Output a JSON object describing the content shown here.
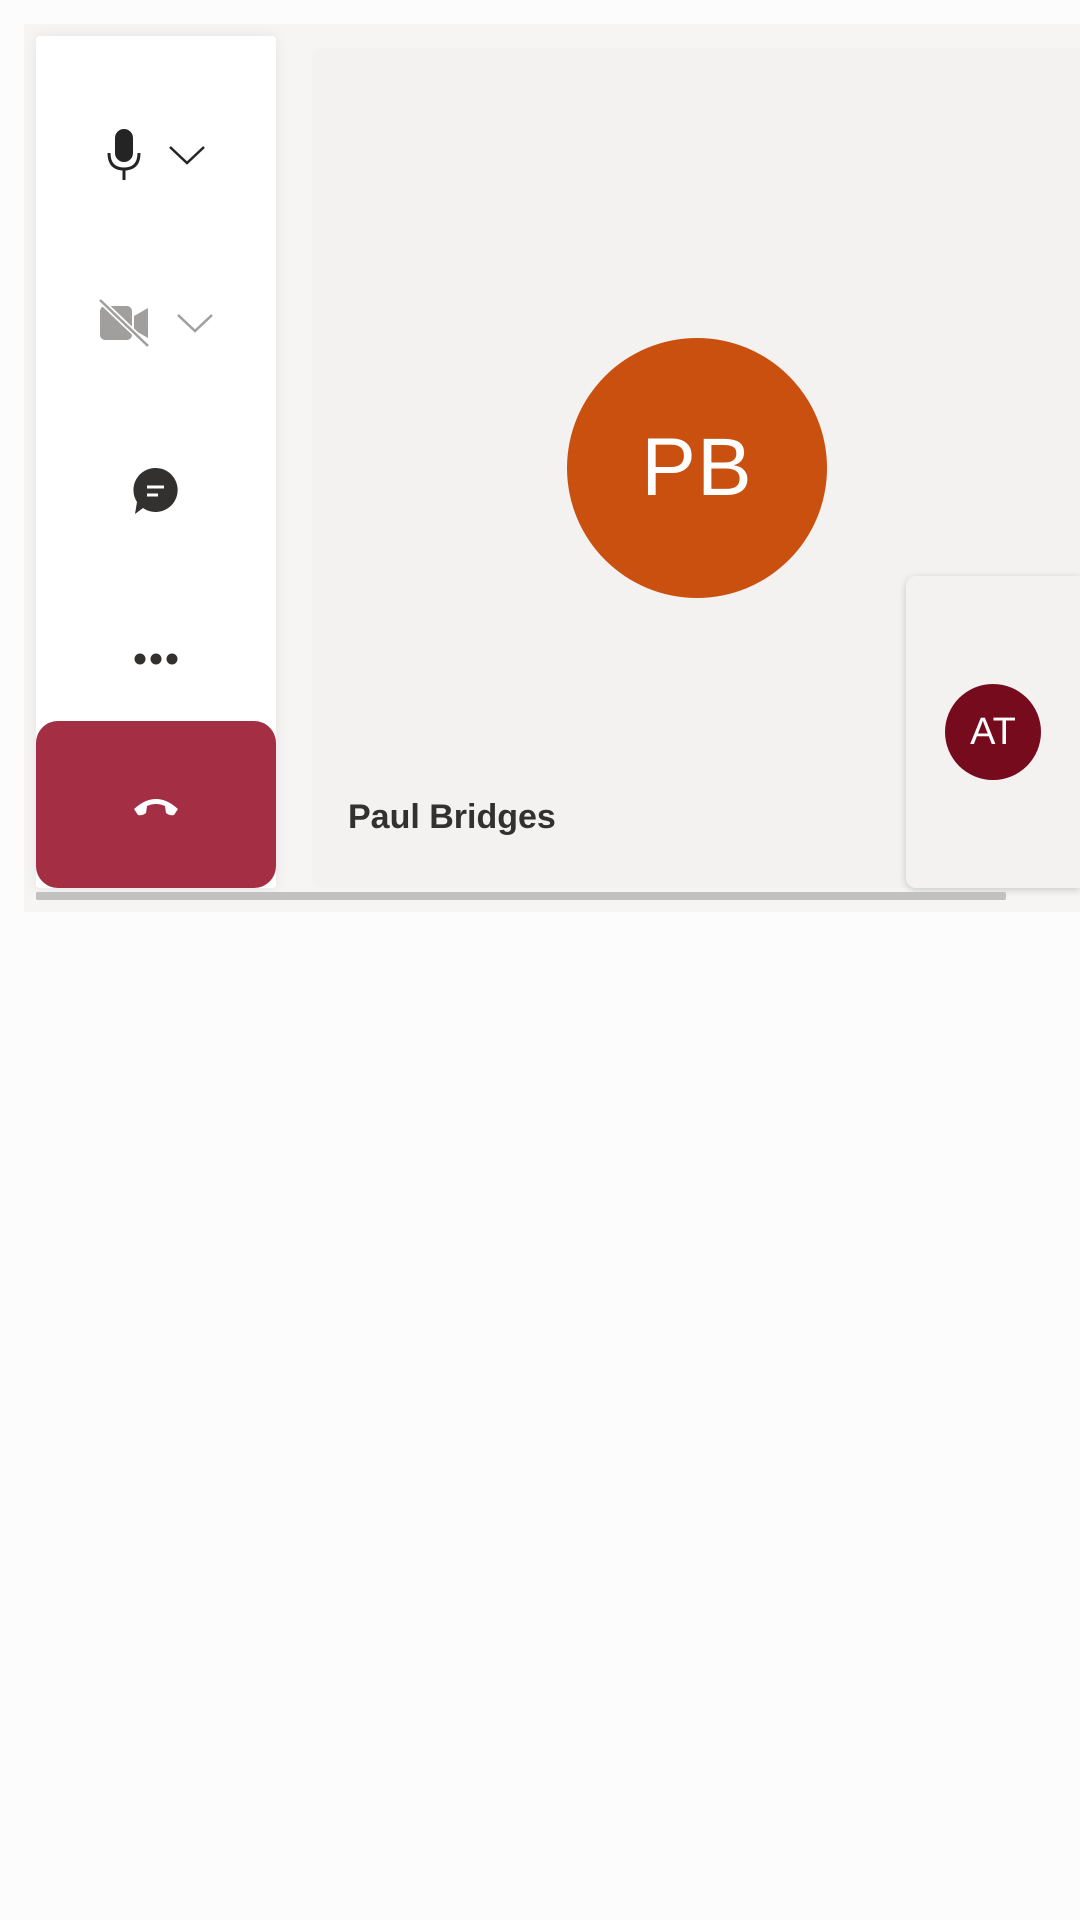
{
  "call": {
    "main_participant": {
      "initials": "PB",
      "name": "Paul Bridges",
      "color": "#ca5010"
    },
    "self_participant": {
      "initials": "AT",
      "color": "#750b1c"
    }
  },
  "controls": {
    "mic": {
      "icon": "microphone-icon",
      "state": "on",
      "has_options": true
    },
    "camera": {
      "icon": "camera-off-icon",
      "state": "off",
      "has_options": true
    },
    "chat": {
      "icon": "chat-icon"
    },
    "more": {
      "icon": "more-icon"
    },
    "hangup": {
      "icon": "hang-up-icon",
      "color": "#a42e43"
    }
  }
}
